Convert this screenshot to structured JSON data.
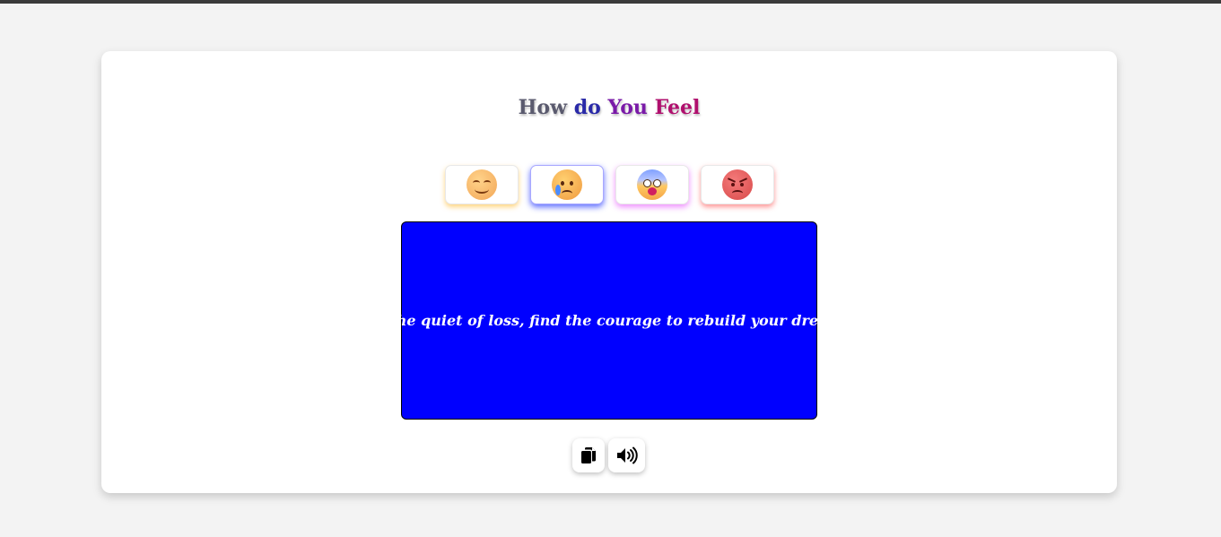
{
  "header": {
    "title_words": [
      "How",
      "do",
      "You",
      "Feel"
    ]
  },
  "moods": [
    {
      "name": "happy",
      "icon": "smiling-face-icon"
    },
    {
      "name": "sad",
      "icon": "crying-face-icon",
      "selected": true
    },
    {
      "name": "scared",
      "icon": "fearful-face-icon"
    },
    {
      "name": "angry",
      "icon": "angry-face-icon"
    }
  ],
  "quote": {
    "text": "In the quiet of loss, find the courage to rebuild your dreams",
    "background": "#0000ff",
    "color": "#ffffff"
  },
  "actions": {
    "copy_icon": "copy-icon",
    "speak_icon": "speaker-icon"
  }
}
